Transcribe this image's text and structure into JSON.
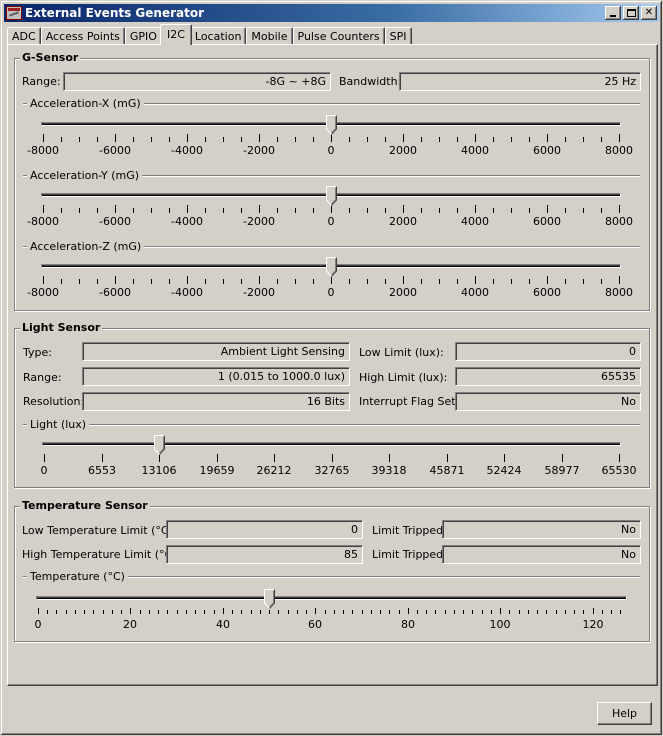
{
  "window": {
    "title": "External Events Generator",
    "controls": {
      "minimize": "minimize",
      "maximize": "maximize",
      "close": "close"
    }
  },
  "tabs": [
    {
      "label": "ADC",
      "active": false
    },
    {
      "label": "Access Points",
      "active": false
    },
    {
      "label": "GPIO",
      "active": false
    },
    {
      "label": "I2C",
      "active": true
    },
    {
      "label": "Location",
      "active": false
    },
    {
      "label": "Mobile",
      "active": false
    },
    {
      "label": "Pulse Counters",
      "active": false
    },
    {
      "label": "SPI",
      "active": false
    }
  ],
  "g_sensor": {
    "title": "G-Sensor",
    "range_label": "Range:",
    "range_value": "-8G ~ +8G",
    "bandwidth_label": "Bandwidth:",
    "bandwidth_value": "25 Hz",
    "sliders": [
      {
        "title": "Acceleration-X (mG)",
        "min": -8000,
        "max": 8000,
        "value": 0,
        "major_tick_step": 2000,
        "minor_tick_step": 500,
        "tick_labels": [
          "-8000",
          "-6000",
          "-4000",
          "-2000",
          "0",
          "2000",
          "4000",
          "6000",
          "8000"
        ]
      },
      {
        "title": "Acceleration-Y (mG)",
        "min": -8000,
        "max": 8000,
        "value": 0,
        "major_tick_step": 2000,
        "minor_tick_step": 500,
        "tick_labels": [
          "-8000",
          "-6000",
          "-4000",
          "-2000",
          "0",
          "2000",
          "4000",
          "6000",
          "8000"
        ]
      },
      {
        "title": "Acceleration-Z (mG)",
        "min": -8000,
        "max": 8000,
        "value": 0,
        "major_tick_step": 2000,
        "minor_tick_step": 500,
        "tick_labels": [
          "-8000",
          "-6000",
          "-4000",
          "-2000",
          "0",
          "2000",
          "4000",
          "6000",
          "8000"
        ]
      }
    ]
  },
  "light_sensor": {
    "title": "Light Sensor",
    "type_label": "Type:",
    "type_value": "Ambient Light Sensing",
    "range_label": "Range:",
    "range_value": "1 (0.015 to 1000.0 lux)",
    "resolution_label": "Resolution:",
    "resolution_value": "16 Bits",
    "low_limit_label": "Low Limit (lux):",
    "low_limit_value": "0",
    "high_limit_label": "High Limit (lux):",
    "high_limit_value": "65535",
    "interrupt_label": "Interrupt Flag Set:",
    "interrupt_value": "No",
    "slider": {
      "title": "Light (lux)",
      "min": 0,
      "max": 65530,
      "value": 13106,
      "major_tick_step": 6553,
      "minor_tick_step": 6553,
      "tick_labels": [
        "0",
        "6553",
        "13106",
        "19659",
        "26212",
        "32765",
        "39318",
        "45871",
        "52424",
        "58977",
        "65530"
      ]
    }
  },
  "temperature_sensor": {
    "title": "Temperature Sensor",
    "low_label": "Low Temperature Limit (°C):",
    "low_value": "0",
    "high_label": "High Temperature Limit (°C):",
    "high_value": "85",
    "low_tripped_label": "Limit Tripped:",
    "low_tripped_value": "No",
    "high_tripped_label": "Limit Tripped:",
    "high_tripped_value": "No",
    "slider": {
      "title": "Temperature (°C)",
      "min": 0,
      "max": 127,
      "value": 50,
      "major_tick_step": 20,
      "minor_tick_step": 2,
      "tick_labels": [
        "0",
        "20",
        "40",
        "60",
        "80",
        "100",
        "120"
      ]
    }
  },
  "footer": {
    "help_label": "Help"
  }
}
